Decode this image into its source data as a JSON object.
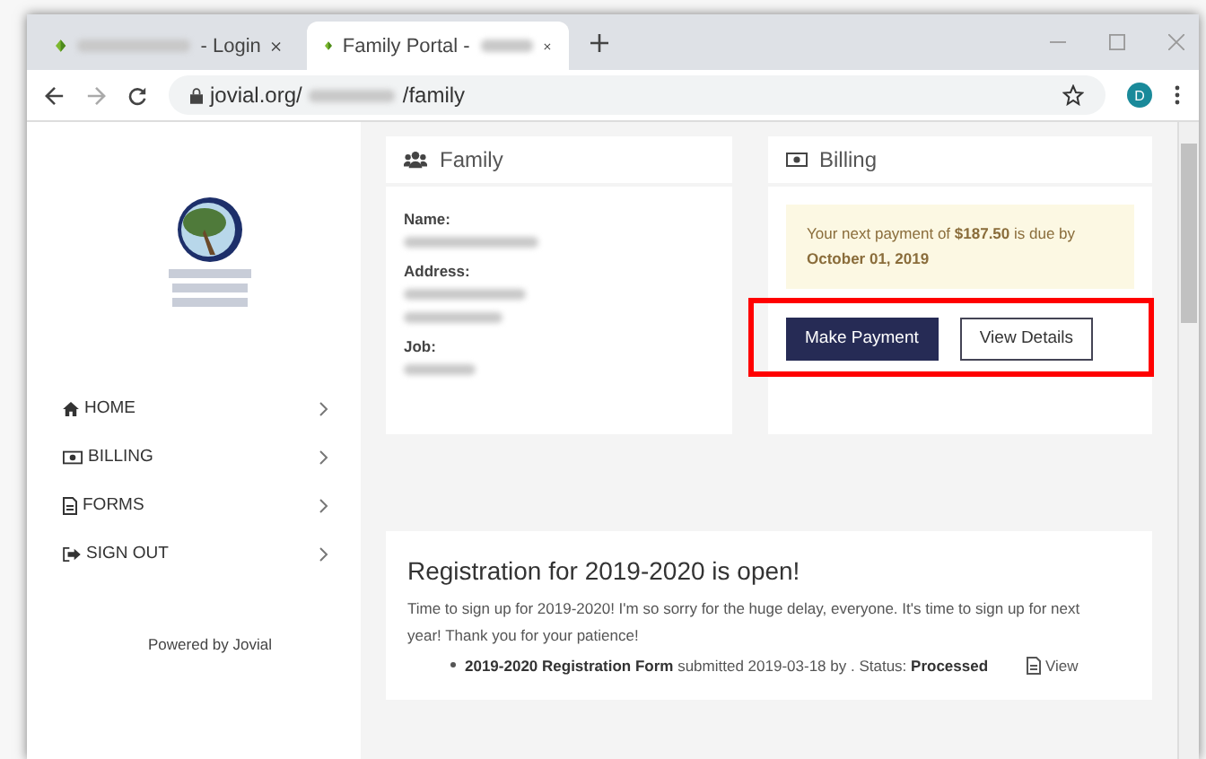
{
  "browser": {
    "tabs": [
      {
        "title": "- Login",
        "selected": false
      },
      {
        "title": "Family Portal -",
        "selected": true
      }
    ],
    "url": {
      "domain": "jovial.org/",
      "path": "/family"
    },
    "avatar": "D"
  },
  "sidebar": {
    "items": [
      {
        "label": "HOME",
        "kind": "home"
      },
      {
        "label": "BILLING",
        "kind": "billing"
      },
      {
        "label": "FORMS",
        "kind": "forms"
      },
      {
        "label": "SIGN OUT",
        "kind": "signout"
      }
    ],
    "footer": "Powered by Jovial"
  },
  "family": {
    "title": "Family",
    "fields": [
      {
        "label": "Name:",
        "values": [
          {
            "kind": "redacted"
          }
        ]
      },
      {
        "label": "Address:",
        "values": [
          {
            "kind": "redacted"
          },
          {
            "kind": "redacted"
          }
        ]
      },
      {
        "label": "Job:",
        "values": [
          {
            "kind": "redacted"
          }
        ]
      }
    ]
  },
  "billing": {
    "title": "Billing",
    "notice": "Your next payment of **$187.50** is due by **October 01, 2019**",
    "highlighted": true,
    "buttons": [
      {
        "label": "Make Payment",
        "kind": "primary"
      },
      {
        "label": "View Details",
        "kind": "secondary"
      }
    ]
  },
  "announcement": {
    "title": "Registration for 2019-2020 is open!",
    "body": "Time to sign up for 2019-2020! I'm so sorry for the huge delay, everyone. It's time to sign up for next year! Thank you for your patience!",
    "submissions": [
      {
        "text": "**2019-2020 Registration Form** submitted 2019-03-18 by . Status: **Processed**",
        "link": "View"
      }
    ]
  }
}
